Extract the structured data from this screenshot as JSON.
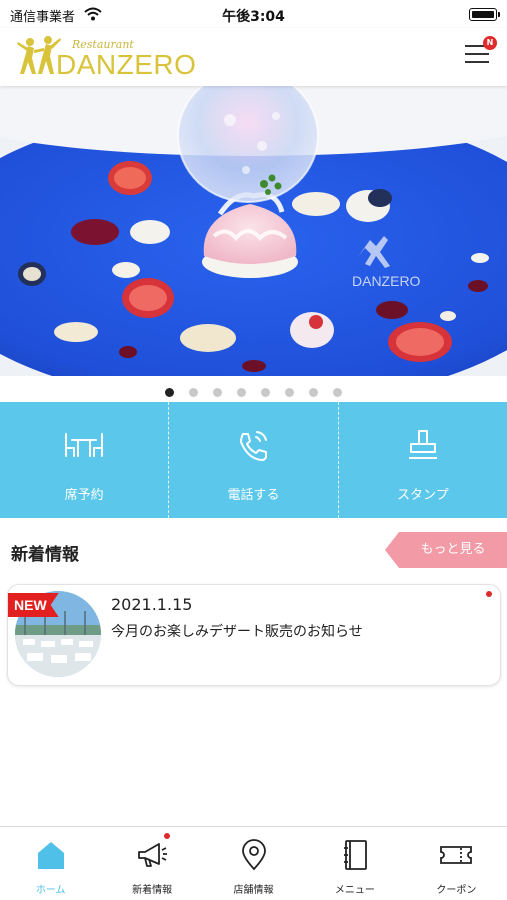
{
  "status_bar": {
    "carrier": "通信事業者",
    "time": "午後3:04"
  },
  "header": {
    "logo_small": "Restaurant",
    "logo_text": "DANZERO",
    "menu_badge": "N"
  },
  "hero": {
    "plate_text": "DANZERO",
    "slide_count": 8,
    "active_slide": 1
  },
  "actions": [
    {
      "label": "席予約",
      "icon": "table-chairs-icon"
    },
    {
      "label": "電話する",
      "icon": "phone-icon"
    },
    {
      "label": "スタンプ",
      "icon": "stamp-icon"
    }
  ],
  "news": {
    "title": "新着情報",
    "more_label": "もっと見る",
    "items": [
      {
        "badge": "NEW",
        "date": "2021.1.15",
        "text": "今月のお楽しみデザート販売のお知らせ"
      }
    ]
  },
  "tabs": [
    {
      "label": "ホーム",
      "icon": "home-icon",
      "active": true
    },
    {
      "label": "新着情報",
      "icon": "megaphone-icon",
      "active": false
    },
    {
      "label": "店舗情報",
      "icon": "map-pin-icon",
      "active": false
    },
    {
      "label": "メニュー",
      "icon": "menu-book-icon",
      "active": false
    },
    {
      "label": "クーポン",
      "icon": "ticket-icon",
      "active": false
    }
  ],
  "colors": {
    "accent": "#5bc7ea",
    "tab_active": "#4fc0e8",
    "more_button": "#f29aa6",
    "new_badge": "#e32020",
    "logo": "#d8c33a",
    "plate_blue": "#1f4fd8"
  }
}
